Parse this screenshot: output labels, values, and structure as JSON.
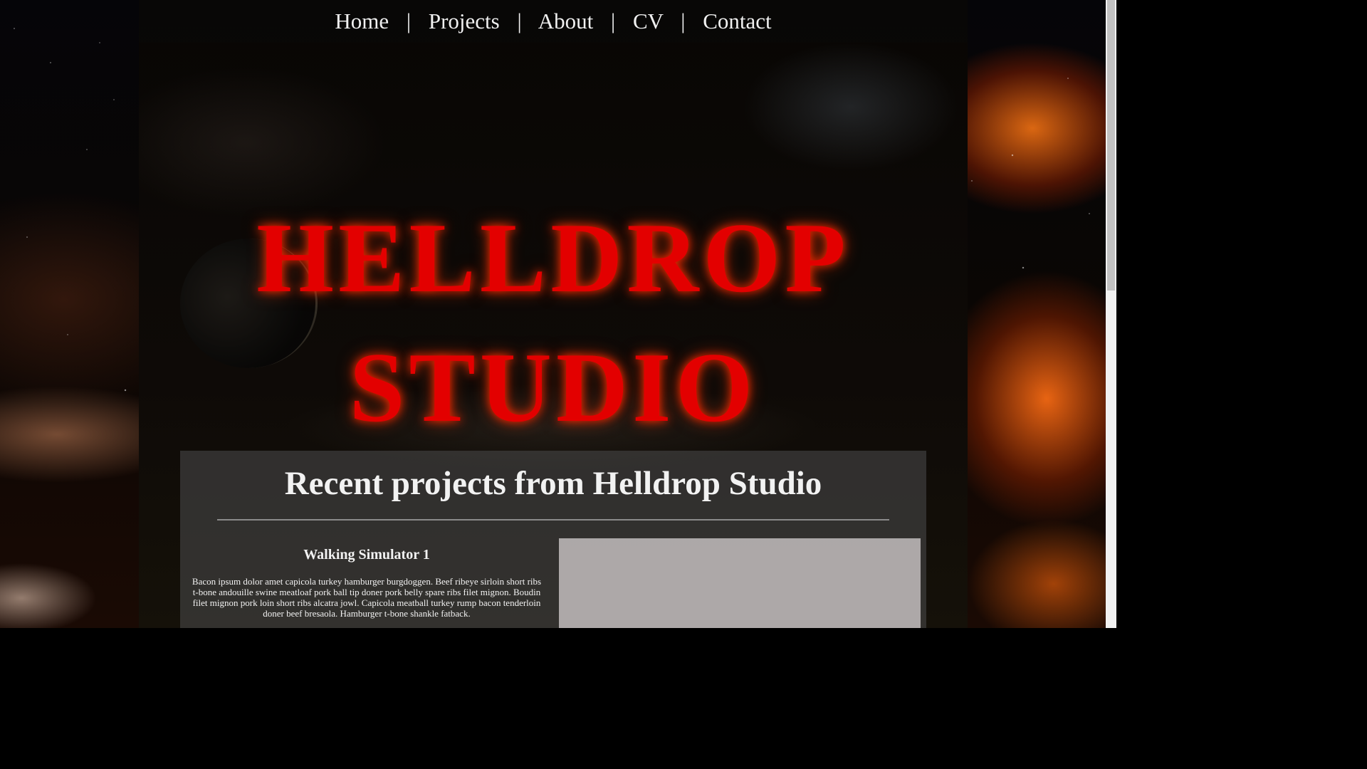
{
  "nav": {
    "items": [
      {
        "label": "Home"
      },
      {
        "label": "Projects"
      },
      {
        "label": "About"
      },
      {
        "label": "CV"
      },
      {
        "label": "Contact"
      }
    ],
    "separator": "|"
  },
  "hero": {
    "line1": "HELLDROP",
    "line2": "STUDIO"
  },
  "projects": {
    "heading": "Recent projects from Helldrop Studio",
    "items": [
      {
        "title": "Walking Simulator 1",
        "description": "Bacon ipsum dolor amet capicola turkey hamburger burgdoggen. Beef ribeye sirloin short ribs t-bone andouille swine meatloaf pork ball tip doner pork belly spare ribs filet mignon. Boudin filet mignon pork loin short ribs alcatra jowl. Capicola meatball turkey rump bacon tenderloin doner beef bresaola. Hamburger t-bone shankle fatback."
      }
    ]
  },
  "colors": {
    "title_red": "#e30000",
    "panel_bg": "#464646"
  }
}
